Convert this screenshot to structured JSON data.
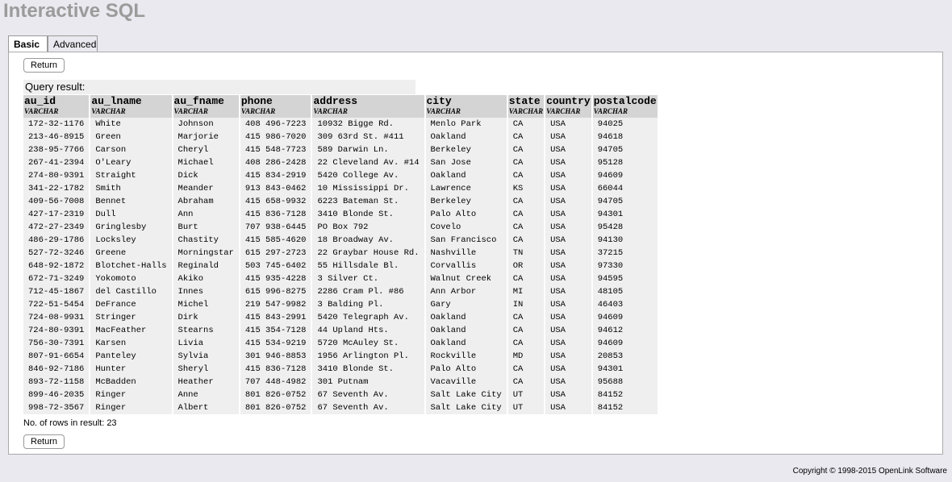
{
  "app": {
    "title": "Interactive SQL"
  },
  "tabs": [
    {
      "label": "Basic",
      "active": true
    },
    {
      "label": "Advanced",
      "active": false
    }
  ],
  "buttons": {
    "return_top": "Return",
    "return_bottom": "Return"
  },
  "query": {
    "label": "Query result:",
    "columns": [
      {
        "name": "au_id",
        "type": "VARCHAR"
      },
      {
        "name": "au_lname",
        "type": "VARCHAR"
      },
      {
        "name": "au_fname",
        "type": "VARCHAR"
      },
      {
        "name": "phone",
        "type": "VARCHAR"
      },
      {
        "name": "address",
        "type": "VARCHAR"
      },
      {
        "name": "city",
        "type": "VARCHAR"
      },
      {
        "name": "state",
        "type": "VARCHAR"
      },
      {
        "name": "country",
        "type": "VARCHAR"
      },
      {
        "name": "postalcode",
        "type": "VARCHAR"
      }
    ],
    "rows": [
      [
        "172-32-1176",
        "White",
        "Johnson",
        "408 496-7223",
        "10932 Bigge Rd.",
        "Menlo Park",
        "CA",
        "USA",
        "94025"
      ],
      [
        "213-46-8915",
        "Green",
        "Marjorie",
        "415 986-7020",
        "309 63rd St. #411",
        "Oakland",
        "CA",
        "USA",
        "94618"
      ],
      [
        "238-95-7766",
        "Carson",
        "Cheryl",
        "415 548-7723",
        "589 Darwin Ln.",
        "Berkeley",
        "CA",
        "USA",
        "94705"
      ],
      [
        "267-41-2394",
        "O'Leary",
        "Michael",
        "408 286-2428",
        "22 Cleveland Av. #14",
        "San Jose",
        "CA",
        "USA",
        "95128"
      ],
      [
        "274-80-9391",
        "Straight",
        "Dick",
        "415 834-2919",
        "5420 College Av.",
        "Oakland",
        "CA",
        "USA",
        "94609"
      ],
      [
        "341-22-1782",
        "Smith",
        "Meander",
        "913 843-0462",
        "10 Mississippi Dr.",
        "Lawrence",
        "KS",
        "USA",
        "66044"
      ],
      [
        "409-56-7008",
        "Bennet",
        "Abraham",
        "415 658-9932",
        "6223 Bateman St.",
        "Berkeley",
        "CA",
        "USA",
        "94705"
      ],
      [
        "427-17-2319",
        "Dull",
        "Ann",
        "415 836-7128",
        "3410 Blonde St.",
        "Palo Alto",
        "CA",
        "USA",
        "94301"
      ],
      [
        "472-27-2349",
        "Gringlesby",
        "Burt",
        "707 938-6445",
        "PO Box 792",
        "Covelo",
        "CA",
        "USA",
        "95428"
      ],
      [
        "486-29-1786",
        "Locksley",
        "Chastity",
        "415 585-4620",
        "18 Broadway Av.",
        "San Francisco",
        "CA",
        "USA",
        "94130"
      ],
      [
        "527-72-3246",
        "Greene",
        "Morningstar",
        "615 297-2723",
        "22 Graybar House Rd.",
        "Nashville",
        "TN",
        "USA",
        "37215"
      ],
      [
        "648-92-1872",
        "Blotchet-Halls",
        "Reginald",
        "503 745-6402",
        "55 Hillsdale Bl.",
        "Corvallis",
        "OR",
        "USA",
        "97330"
      ],
      [
        "672-71-3249",
        "Yokomoto",
        "Akiko",
        "415 935-4228",
        "3 Silver Ct.",
        "Walnut Creek",
        "CA",
        "USA",
        "94595"
      ],
      [
        "712-45-1867",
        "del Castillo",
        "Innes",
        "615 996-8275",
        "2286 Cram Pl. #86",
        "Ann Arbor",
        "MI",
        "USA",
        "48105"
      ],
      [
        "722-51-5454",
        "DeFrance",
        "Michel",
        "219 547-9982",
        "3 Balding Pl.",
        "Gary",
        "IN",
        "USA",
        "46403"
      ],
      [
        "724-08-9931",
        "Stringer",
        "Dirk",
        "415 843-2991",
        "5420 Telegraph Av.",
        "Oakland",
        "CA",
        "USA",
        "94609"
      ],
      [
        "724-80-9391",
        "MacFeather",
        "Stearns",
        "415 354-7128",
        "44 Upland Hts.",
        "Oakland",
        "CA",
        "USA",
        "94612"
      ],
      [
        "756-30-7391",
        "Karsen",
        "Livia",
        "415 534-9219",
        "5720 McAuley St.",
        "Oakland",
        "CA",
        "USA",
        "94609"
      ],
      [
        "807-91-6654",
        "Panteley",
        "Sylvia",
        "301 946-8853",
        "1956 Arlington Pl.",
        "Rockville",
        "MD",
        "USA",
        "20853"
      ],
      [
        "846-92-7186",
        "Hunter",
        "Sheryl",
        "415 836-7128",
        "3410 Blonde St.",
        "Palo Alto",
        "CA",
        "USA",
        "94301"
      ],
      [
        "893-72-1158",
        "McBadden",
        "Heather",
        "707 448-4982",
        "301 Putnam",
        "Vacaville",
        "CA",
        "USA",
        "95688"
      ],
      [
        "899-46-2035",
        "Ringer",
        "Anne",
        "801 826-0752",
        "67 Seventh Av.",
        "Salt Lake City",
        "UT",
        "USA",
        "84152"
      ],
      [
        "998-72-3567",
        "Ringer",
        "Albert",
        "801 826-0752",
        "67 Seventh Av.",
        "Salt Lake City",
        "UT",
        "USA",
        "84152"
      ]
    ],
    "row_count_text": "No. of rows in result: 23"
  },
  "footer": {
    "copyright": "Copyright © 1998-2015 OpenLink Software"
  }
}
